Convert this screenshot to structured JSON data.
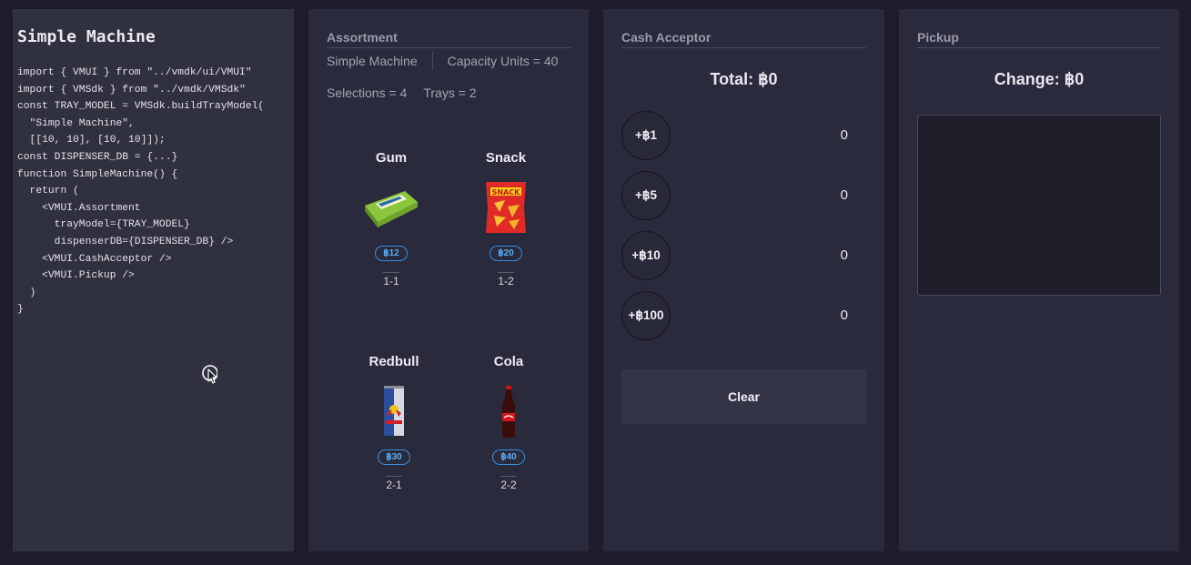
{
  "code": {
    "title": "Simple Machine",
    "source": "import { VMUI } from \"../vmdk/ui/VMUI\"\nimport { VMSdk } from \"../vmdk/VMSdk\"\nconst TRAY_MODEL = VMSdk.buildTrayModel(\n  \"Simple Machine\",\n  [[10, 10], [10, 10]]);\nconst DISPENSER_DB = {...}\nfunction SimpleMachine() {\n  return (\n    <VMUI.Assortment\n      trayModel={TRAY_MODEL}\n      dispenserDB={DISPENSER_DB} />\n    <VMUI.CashAcceptor />\n    <VMUI.Pickup />\n  )\n}"
  },
  "assortment": {
    "title": "Assortment",
    "machine_name": "Simple Machine",
    "capacity": "Capacity Units = 40",
    "selections": "Selections = 4",
    "trays": "Trays = 2",
    "items": [
      {
        "name": "Gum",
        "price": "฿12",
        "id": "1-1",
        "icon": "gum-pack"
      },
      {
        "name": "Snack",
        "price": "฿20",
        "id": "1-2",
        "icon": "snack-bag"
      },
      {
        "name": "Redbull",
        "price": "฿30",
        "id": "2-1",
        "icon": "energy-can"
      },
      {
        "name": "Cola",
        "price": "฿40",
        "id": "2-2",
        "icon": "cola-bottle"
      }
    ]
  },
  "cash": {
    "title": "Cash Acceptor",
    "total": "Total: ฿0",
    "coins": [
      {
        "label": "+฿1",
        "count": "0"
      },
      {
        "label": "+฿5",
        "count": "0"
      },
      {
        "label": "+฿10",
        "count": "0"
      },
      {
        "label": "+฿100",
        "count": "0"
      }
    ],
    "clear_label": "Clear"
  },
  "pickup": {
    "title": "Pickup",
    "change": "Change: ฿0"
  },
  "colors": {
    "background": "#1c1c2a",
    "panel": "#292a3b",
    "price_accent": "#3b8fe0"
  }
}
